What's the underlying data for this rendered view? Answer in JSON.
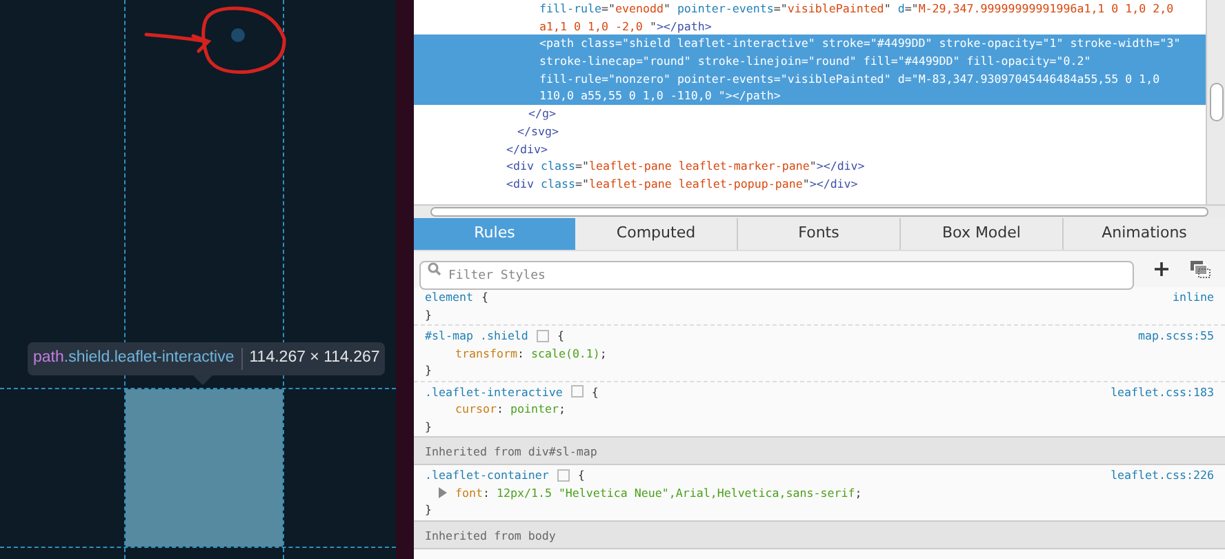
{
  "canvas": {
    "tooltip": {
      "tag": "path",
      "classes": ".shield.leaflet-interactive",
      "size": "114.267 × 114.267"
    }
  },
  "markup": [
    {
      "children": [
        {
          "children": [
            {
              "children": [
                {
                  "selected": false,
                  "lines": [
                    [
                      {
                        "kind": "attr",
                        "text": "fill-rule"
                      },
                      {
                        "kind": "punct",
                        "text": "=\""
                      },
                      {
                        "kind": "value",
                        "text": "evenodd"
                      },
                      {
                        "kind": "punct",
                        "text": "\" "
                      },
                      {
                        "kind": "attr",
                        "text": "pointer-events"
                      },
                      {
                        "kind": "punct",
                        "text": "=\""
                      },
                      {
                        "kind": "value",
                        "text": "visiblePainted"
                      },
                      {
                        "kind": "punct",
                        "text": "\" "
                      },
                      {
                        "kind": "attr",
                        "text": "d"
                      },
                      {
                        "kind": "punct",
                        "text": "=\""
                      },
                      {
                        "kind": "value",
                        "text": "M-29,347.99999999991996a1,1 0 1,0 2,0"
                      }
                    ],
                    [
                      {
                        "kind": "value",
                        "text": "a1,1 0 1,0 -2,0 "
                      },
                      {
                        "kind": "punct",
                        "text": "\""
                      },
                      {
                        "kind": "tag",
                        "text": "></path>"
                      }
                    ]
                  ]
                },
                {
                  "selected": true,
                  "lines": [
                    [
                      {
                        "kind": "tag",
                        "text": "<path "
                      },
                      {
                        "kind": "attr",
                        "text": "class"
                      },
                      {
                        "kind": "punct",
                        "text": "=\""
                      },
                      {
                        "kind": "value",
                        "text": "shield leaflet-interactive"
                      },
                      {
                        "kind": "punct",
                        "text": "\" "
                      },
                      {
                        "kind": "attr",
                        "text": "stroke"
                      },
                      {
                        "kind": "punct",
                        "text": "=\""
                      },
                      {
                        "kind": "value",
                        "text": "#4499DD"
                      },
                      {
                        "kind": "punct",
                        "text": "\" "
                      },
                      {
                        "kind": "attr",
                        "text": "stroke-opacity"
                      },
                      {
                        "kind": "punct",
                        "text": "=\""
                      },
                      {
                        "kind": "value",
                        "text": "1"
                      },
                      {
                        "kind": "punct",
                        "text": "\" "
                      },
                      {
                        "kind": "attr",
                        "text": "stroke-width"
                      },
                      {
                        "kind": "punct",
                        "text": "=\""
                      },
                      {
                        "kind": "value",
                        "text": "3"
                      },
                      {
                        "kind": "punct",
                        "text": "\""
                      }
                    ],
                    [
                      {
                        "kind": "attr",
                        "text": "stroke-linecap"
                      },
                      {
                        "kind": "punct",
                        "text": "=\""
                      },
                      {
                        "kind": "value",
                        "text": "round"
                      },
                      {
                        "kind": "punct",
                        "text": "\" "
                      },
                      {
                        "kind": "attr",
                        "text": "stroke-linejoin"
                      },
                      {
                        "kind": "punct",
                        "text": "=\""
                      },
                      {
                        "kind": "value",
                        "text": "round"
                      },
                      {
                        "kind": "punct",
                        "text": "\" "
                      },
                      {
                        "kind": "attr",
                        "text": "fill"
                      },
                      {
                        "kind": "punct",
                        "text": "=\""
                      },
                      {
                        "kind": "value",
                        "text": "#4499DD"
                      },
                      {
                        "kind": "punct",
                        "text": "\" "
                      },
                      {
                        "kind": "attr",
                        "text": "fill-opacity"
                      },
                      {
                        "kind": "punct",
                        "text": "=\""
                      },
                      {
                        "kind": "value",
                        "text": "0.2"
                      },
                      {
                        "kind": "punct",
                        "text": "\""
                      }
                    ],
                    [
                      {
                        "kind": "attr",
                        "text": "fill-rule"
                      },
                      {
                        "kind": "punct",
                        "text": "=\""
                      },
                      {
                        "kind": "value",
                        "text": "nonzero"
                      },
                      {
                        "kind": "punct",
                        "text": "\" "
                      },
                      {
                        "kind": "attr",
                        "text": "pointer-events"
                      },
                      {
                        "kind": "punct",
                        "text": "=\""
                      },
                      {
                        "kind": "value",
                        "text": "visiblePainted"
                      },
                      {
                        "kind": "punct",
                        "text": "\" "
                      },
                      {
                        "kind": "attr",
                        "text": "d"
                      },
                      {
                        "kind": "punct",
                        "text": "=\""
                      },
                      {
                        "kind": "value",
                        "text": "M-83,347.93097045446484a55,55 0 1,0"
                      }
                    ],
                    [
                      {
                        "kind": "value",
                        "text": "110,0 a55,55 0 1,0 -110,0 "
                      },
                      {
                        "kind": "punct",
                        "text": "\""
                      },
                      {
                        "kind": "tag",
                        "text": "></path>"
                      }
                    ]
                  ]
                }
              ]
            },
            {
              "selected": false,
              "lines": [
                [
                  {
                    "kind": "tag",
                    "text": "</g>"
                  }
                ]
              ]
            }
          ]
        },
        {
          "selected": false,
          "lines": [
            [
              {
                "kind": "tag",
                "text": "</svg>"
              }
            ]
          ]
        }
      ]
    },
    {
      "selected": false,
      "lines": [
        [
          {
            "kind": "tag",
            "text": "</div>"
          }
        ]
      ]
    },
    {
      "selected": false,
      "lines": [
        [
          {
            "kind": "tag",
            "text": "<div "
          },
          {
            "kind": "attr",
            "text": "class"
          },
          {
            "kind": "punct",
            "text": "=\""
          },
          {
            "kind": "value",
            "text": "leaflet-pane leaflet-marker-pane"
          },
          {
            "kind": "punct",
            "text": "\""
          },
          {
            "kind": "tag",
            "text": "></div>"
          }
        ]
      ]
    },
    {
      "selected": false,
      "lines": [
        [
          {
            "kind": "tag",
            "text": "<div "
          },
          {
            "kind": "attr",
            "text": "class"
          },
          {
            "kind": "punct",
            "text": "=\""
          },
          {
            "kind": "value",
            "text": "leaflet-pane leaflet-popup-pane"
          },
          {
            "kind": "punct",
            "text": "\""
          },
          {
            "kind": "tag",
            "text": "></div>"
          }
        ]
      ]
    }
  ],
  "tabs": [
    {
      "label": "Rules",
      "selected": true
    },
    {
      "label": "Computed",
      "selected": false
    },
    {
      "label": "Fonts",
      "selected": false
    },
    {
      "label": "Box Model",
      "selected": false
    },
    {
      "label": "Animations",
      "selected": false
    }
  ],
  "filter": {
    "placeholder": "Filter Styles"
  },
  "rules": [
    {
      "kind": "rule",
      "selector": "element",
      "opening": "{",
      "source": "inline",
      "closing": "}"
    },
    {
      "kind": "rule",
      "selector": "#sl-map .shield",
      "opening": "{",
      "source": "map.scss:55",
      "closing": "}",
      "declarations": [
        {
          "property": "transform",
          "colon": ":",
          "value": "scale(0.1)",
          "semicolon": ";",
          "expandable": false
        }
      ]
    },
    {
      "kind": "rule",
      "selector": ".leaflet-interactive",
      "opening": "{",
      "source": "leaflet.css:183",
      "closing": "}",
      "declarations": [
        {
          "property": "cursor",
          "colon": ":",
          "value": "pointer",
          "semicolon": ";",
          "expandable": false
        }
      ]
    },
    {
      "kind": "header",
      "text": "Inherited from div#sl-map"
    },
    {
      "kind": "rule",
      "selector": ".leaflet-container",
      "opening": "{",
      "source": "leaflet.css:226",
      "closing": "}",
      "declarations": [
        {
          "property": "font",
          "colon": ":",
          "value": "12px/1.5 \"Helvetica Neue\",Arial,Helvetica,sans-serif",
          "semicolon": ";",
          "expandable": true
        }
      ]
    },
    {
      "kind": "header",
      "text": "Inherited from body"
    }
  ]
}
